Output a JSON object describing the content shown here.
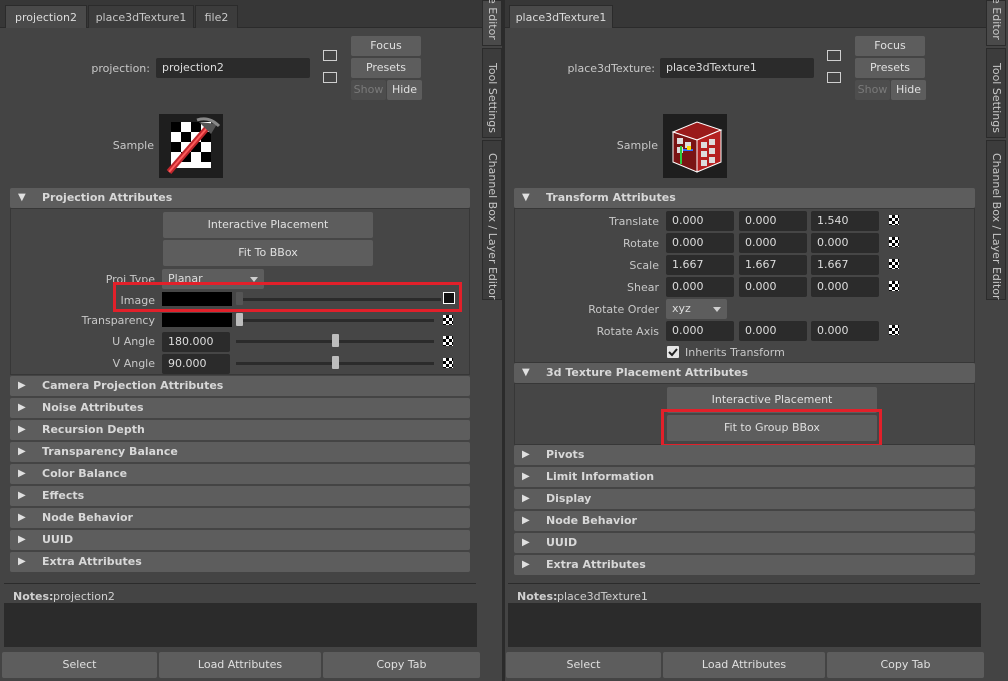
{
  "left": {
    "tabs": [
      {
        "label": "projection2",
        "active": true
      },
      {
        "label": "place3dTexture1",
        "active": false
      },
      {
        "label": "file2",
        "active": false
      }
    ],
    "node_label": "projection:",
    "node_value": "projection2",
    "buttons": {
      "focus": "Focus",
      "presets": "Presets",
      "show": "Show",
      "hide": "Hide"
    },
    "sample_label": "Sample",
    "section_open": "Projection Attributes",
    "interactive_placement": "Interactive Placement",
    "fit_to_bbox": "Fit To BBox",
    "proj_type_label": "Proj Type",
    "proj_type_value": "Planar",
    "image_label": "Image",
    "transparency_label": "Transparency",
    "u_angle_label": "U Angle",
    "u_angle_value": "180.000",
    "v_angle_label": "V Angle",
    "v_angle_value": "90.000",
    "u_angle_slider": 0.5,
    "v_angle_slider": 0.5,
    "collapsed_sections": [
      "Camera Projection Attributes",
      "Noise Attributes",
      "Recursion Depth",
      "Transparency Balance",
      "Color Balance",
      "Effects",
      "Node Behavior",
      "UUID",
      "Extra Attributes"
    ],
    "notes_label": "Notes:",
    "notes_node": "projection2",
    "bottom_buttons": {
      "select": "Select",
      "load": "Load Attributes",
      "copy": "Copy Tab"
    }
  },
  "right": {
    "tabs": [
      {
        "label": "place3dTexture1",
        "active": true
      }
    ],
    "node_label": "place3dTexture:",
    "node_value": "place3dTexture1",
    "buttons": {
      "focus": "Focus",
      "presets": "Presets",
      "show": "Show",
      "hide": "Hide"
    },
    "sample_label": "Sample",
    "transform_section": "Transform Attributes",
    "translate_label": "Translate",
    "translate": [
      "0.000",
      "0.000",
      "1.540"
    ],
    "rotate_label": "Rotate",
    "rotate": [
      "0.000",
      "0.000",
      "0.000"
    ],
    "scale_label": "Scale",
    "scale": [
      "1.667",
      "1.667",
      "1.667"
    ],
    "shear_label": "Shear",
    "shear": [
      "0.000",
      "0.000",
      "0.000"
    ],
    "rotate_order_label": "Rotate Order",
    "rotate_order_value": "xyz",
    "rotate_axis_label": "Rotate Axis",
    "rotate_axis": [
      "0.000",
      "0.000",
      "0.000"
    ],
    "inherits_transform": "Inherits Transform",
    "placement_section": "3d Texture Placement Attributes",
    "interactive_placement": "Interactive Placement",
    "fit_to_group_bbox": "Fit to Group BBox",
    "collapsed_sections": [
      "Pivots",
      "Limit Information",
      "Display",
      "Node Behavior",
      "UUID",
      "Extra Attributes"
    ],
    "notes_label": "Notes:",
    "notes_node": "place3dTexture1",
    "bottom_buttons": {
      "select": "Select",
      "load": "Load Attributes",
      "copy": "Copy Tab"
    }
  },
  "side_tabs": {
    "attribute_editor": "e Editor",
    "tool_settings": "Tool Settings",
    "channel_box": "Channel Box / Layer Editor"
  },
  "colors": {
    "highlight": "#e2202a"
  }
}
